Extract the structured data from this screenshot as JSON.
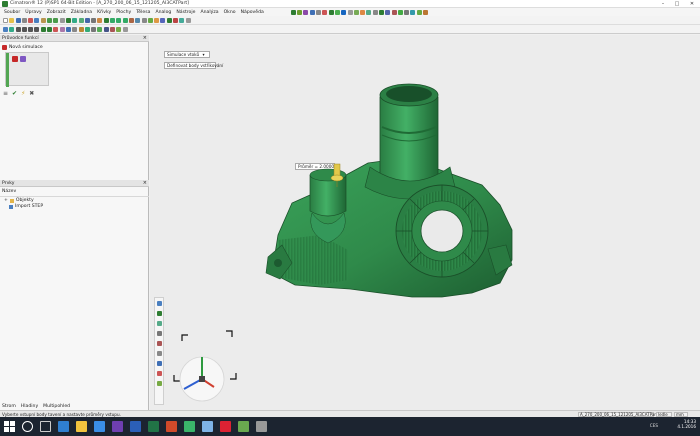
{
  "window": {
    "title": "Cimatron® 12 (P)SP1 64-Bit Edition - [A_270_200_06_15_121205_AI3CATPart]",
    "controls": [
      "–",
      "□",
      "✕"
    ]
  },
  "menubar": {
    "items": [
      "Soubor",
      "Úpravy",
      "Zobrazit",
      "Základna",
      "Křivky",
      "Plochy",
      "Tělesa",
      "Analog",
      "Nástroje",
      "Analýza",
      "Okno",
      "Nápověda"
    ]
  },
  "left_panel": {
    "wizard_title": "Průvodce funkcí",
    "wizard_item": "Nová simulace",
    "tree_title": "Prvky",
    "tree_subheader": "Název",
    "tree_items": [
      {
        "label": "Objekty",
        "expander": "+"
      },
      {
        "label": "Import STEP",
        "expander": ""
      }
    ],
    "bottom_tabs": [
      "Strom",
      "Hladiny",
      "Multipohled"
    ],
    "actions": [
      "≡",
      "✔",
      "⚡",
      "✖"
    ]
  },
  "viewport": {
    "dropdown_label": "Simulace vtoků",
    "tooltip_label": "Definovat body vstřikování",
    "diameter_label": "Průměr = 2.0000",
    "colors": {
      "part_green": "#2f8a4a",
      "part_dark": "#1f6a35",
      "gate_yellow": "#e2c84a"
    }
  },
  "statusbar": {
    "message": "Vyberte vstupní body tavení a nastavte průměry vstupu.",
    "cells": [
      "A_270_200_06_15_121205_AI3CATPart",
      "ledle",
      "mm"
    ]
  },
  "taskbar": {
    "time": "14:33",
    "date": "4.1.2016",
    "lang": "CES"
  }
}
